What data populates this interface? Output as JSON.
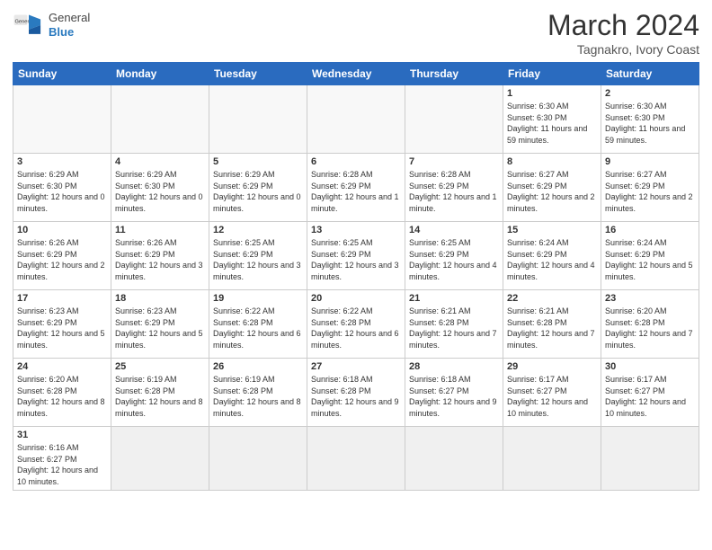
{
  "header": {
    "logo_general": "General",
    "logo_blue": "Blue",
    "month_title": "March 2024",
    "location": "Tagnakro, Ivory Coast"
  },
  "days_of_week": [
    "Sunday",
    "Monday",
    "Tuesday",
    "Wednesday",
    "Thursday",
    "Friday",
    "Saturday"
  ],
  "weeks": [
    [
      {
        "day": "",
        "info": "",
        "empty": true
      },
      {
        "day": "",
        "info": "",
        "empty": true
      },
      {
        "day": "",
        "info": "",
        "empty": true
      },
      {
        "day": "",
        "info": "",
        "empty": true
      },
      {
        "day": "",
        "info": "",
        "empty": true
      },
      {
        "day": "1",
        "info": "Sunrise: 6:30 AM\nSunset: 6:30 PM\nDaylight: 11 hours\nand 59 minutes."
      },
      {
        "day": "2",
        "info": "Sunrise: 6:30 AM\nSunset: 6:30 PM\nDaylight: 11 hours\nand 59 minutes."
      }
    ],
    [
      {
        "day": "3",
        "info": "Sunrise: 6:29 AM\nSunset: 6:30 PM\nDaylight: 12 hours\nand 0 minutes."
      },
      {
        "day": "4",
        "info": "Sunrise: 6:29 AM\nSunset: 6:30 PM\nDaylight: 12 hours\nand 0 minutes."
      },
      {
        "day": "5",
        "info": "Sunrise: 6:29 AM\nSunset: 6:29 PM\nDaylight: 12 hours\nand 0 minutes."
      },
      {
        "day": "6",
        "info": "Sunrise: 6:28 AM\nSunset: 6:29 PM\nDaylight: 12 hours\nand 1 minute."
      },
      {
        "day": "7",
        "info": "Sunrise: 6:28 AM\nSunset: 6:29 PM\nDaylight: 12 hours\nand 1 minute."
      },
      {
        "day": "8",
        "info": "Sunrise: 6:27 AM\nSunset: 6:29 PM\nDaylight: 12 hours\nand 2 minutes."
      },
      {
        "day": "9",
        "info": "Sunrise: 6:27 AM\nSunset: 6:29 PM\nDaylight: 12 hours\nand 2 minutes."
      }
    ],
    [
      {
        "day": "10",
        "info": "Sunrise: 6:26 AM\nSunset: 6:29 PM\nDaylight: 12 hours\nand 2 minutes."
      },
      {
        "day": "11",
        "info": "Sunrise: 6:26 AM\nSunset: 6:29 PM\nDaylight: 12 hours\nand 3 minutes."
      },
      {
        "day": "12",
        "info": "Sunrise: 6:25 AM\nSunset: 6:29 PM\nDaylight: 12 hours\nand 3 minutes."
      },
      {
        "day": "13",
        "info": "Sunrise: 6:25 AM\nSunset: 6:29 PM\nDaylight: 12 hours\nand 3 minutes."
      },
      {
        "day": "14",
        "info": "Sunrise: 6:25 AM\nSunset: 6:29 PM\nDaylight: 12 hours\nand 4 minutes."
      },
      {
        "day": "15",
        "info": "Sunrise: 6:24 AM\nSunset: 6:29 PM\nDaylight: 12 hours\nand 4 minutes."
      },
      {
        "day": "16",
        "info": "Sunrise: 6:24 AM\nSunset: 6:29 PM\nDaylight: 12 hours\nand 5 minutes."
      }
    ],
    [
      {
        "day": "17",
        "info": "Sunrise: 6:23 AM\nSunset: 6:29 PM\nDaylight: 12 hours\nand 5 minutes."
      },
      {
        "day": "18",
        "info": "Sunrise: 6:23 AM\nSunset: 6:29 PM\nDaylight: 12 hours\nand 5 minutes."
      },
      {
        "day": "19",
        "info": "Sunrise: 6:22 AM\nSunset: 6:28 PM\nDaylight: 12 hours\nand 6 minutes."
      },
      {
        "day": "20",
        "info": "Sunrise: 6:22 AM\nSunset: 6:28 PM\nDaylight: 12 hours\nand 6 minutes."
      },
      {
        "day": "21",
        "info": "Sunrise: 6:21 AM\nSunset: 6:28 PM\nDaylight: 12 hours\nand 7 minutes."
      },
      {
        "day": "22",
        "info": "Sunrise: 6:21 AM\nSunset: 6:28 PM\nDaylight: 12 hours\nand 7 minutes."
      },
      {
        "day": "23",
        "info": "Sunrise: 6:20 AM\nSunset: 6:28 PM\nDaylight: 12 hours\nand 7 minutes."
      }
    ],
    [
      {
        "day": "24",
        "info": "Sunrise: 6:20 AM\nSunset: 6:28 PM\nDaylight: 12 hours\nand 8 minutes."
      },
      {
        "day": "25",
        "info": "Sunrise: 6:19 AM\nSunset: 6:28 PM\nDaylight: 12 hours\nand 8 minutes."
      },
      {
        "day": "26",
        "info": "Sunrise: 6:19 AM\nSunset: 6:28 PM\nDaylight: 12 hours\nand 8 minutes."
      },
      {
        "day": "27",
        "info": "Sunrise: 6:18 AM\nSunset: 6:28 PM\nDaylight: 12 hours\nand 9 minutes."
      },
      {
        "day": "28",
        "info": "Sunrise: 6:18 AM\nSunset: 6:27 PM\nDaylight: 12 hours\nand 9 minutes."
      },
      {
        "day": "29",
        "info": "Sunrise: 6:17 AM\nSunset: 6:27 PM\nDaylight: 12 hours\nand 10 minutes."
      },
      {
        "day": "30",
        "info": "Sunrise: 6:17 AM\nSunset: 6:27 PM\nDaylight: 12 hours\nand 10 minutes."
      }
    ],
    [
      {
        "day": "31",
        "info": "Sunrise: 6:16 AM\nSunset: 6:27 PM\nDaylight: 12 hours\nand 10 minutes."
      },
      {
        "day": "",
        "info": "",
        "empty": true
      },
      {
        "day": "",
        "info": "",
        "empty": true
      },
      {
        "day": "",
        "info": "",
        "empty": true
      },
      {
        "day": "",
        "info": "",
        "empty": true
      },
      {
        "day": "",
        "info": "",
        "empty": true
      },
      {
        "day": "",
        "info": "",
        "empty": true
      }
    ]
  ]
}
